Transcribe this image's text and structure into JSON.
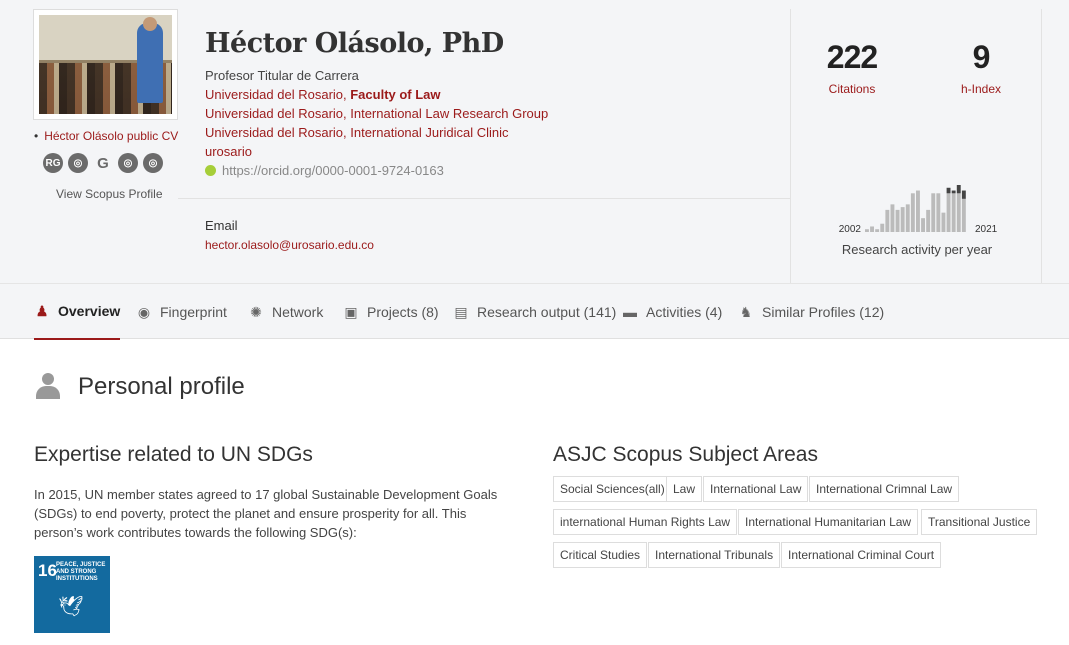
{
  "profile": {
    "name": "Héctor Olásolo, PhD",
    "cv_link": "Héctor Olásolo public CV",
    "scopus_link": "View Scopus Profile",
    "ext_icons": [
      "RG",
      "globe-icon",
      "google-icon",
      "globe-icon",
      "globe-icon"
    ],
    "title": "Profesor Titular de Carrera",
    "affil1_org": "Universidad del Rosario, ",
    "affil1_unit": "Faculty of Law",
    "affil2": "Universidad del Rosario, International Law Research Group",
    "affil3": "Universidad del Rosario, International Juridical Clinic",
    "affil4": "urosario",
    "orcid": "https://orcid.org/0000-0001-9724-0163",
    "email_label": "Email",
    "email": "hector.olasolo@urosario.edu.co"
  },
  "stats": {
    "citations_value": "222",
    "citations_label": "Citations",
    "hindex_value": "9",
    "hindex_label": "h-Index",
    "activity_label": "Research activity per year"
  },
  "chart_data": {
    "type": "bar",
    "start_label": "2002",
    "end_label": "2021",
    "x": [
      2002,
      2003,
      2004,
      2005,
      2006,
      2007,
      2008,
      2009,
      2010,
      2011,
      2012,
      2013,
      2014,
      2015,
      2016,
      2017,
      2018,
      2019,
      2020,
      2021
    ],
    "series": [
      {
        "values": [
          1,
          2,
          1,
          3,
          8,
          10,
          8,
          9,
          10,
          14,
          15,
          5,
          8,
          14,
          14,
          7,
          14,
          14,
          14,
          12
        ]
      },
      {
        "values": [
          0,
          0,
          0,
          0,
          0,
          0,
          0,
          0,
          0,
          0,
          0,
          0,
          0,
          0,
          0,
          0,
          2,
          1,
          3,
          3
        ]
      }
    ],
    "colors": [
      "#bbbbbb",
      "#444444"
    ]
  },
  "tabs": [
    {
      "label": "Overview",
      "icon": "person-icon"
    },
    {
      "label": "Fingerprint",
      "icon": "fingerprint-icon"
    },
    {
      "label": "Network",
      "icon": "network-icon"
    },
    {
      "label": "Projects (8)",
      "icon": "box-icon"
    },
    {
      "label": "Research output (141)",
      "icon": "book-icon"
    },
    {
      "label": "Activities (4)",
      "icon": "briefcase-icon"
    },
    {
      "label": "Similar Profiles (12)",
      "icon": "people-icon"
    }
  ],
  "personal_profile": {
    "title": "Personal profile",
    "sdg_title": "Expertise related to UN SDGs",
    "sdg_text": "In 2015, UN member states agreed to 17 global Sustainable Development Goals (SDGs) to end poverty, protect the planet and ensure prosperity for all. This person’s work contributes towards the following SDG(s):",
    "sdg_number": "16",
    "sdg_label": "PEACE, JUSTICE AND STRONG INSTITUTIONS",
    "asjc_title": "ASJC Scopus Subject Areas",
    "asjc_tags": [
      "Social Sciences(all)",
      "Law",
      "International Law",
      "International Crimnal Law",
      "international Human Rights Law",
      "International Humanitarian Law",
      "Transitional Justice",
      "Critical Studies",
      "International Tribunals",
      "International Criminal Court"
    ]
  },
  "colors": {
    "accent": "#9b1a1a",
    "header_bg": "#f4f5f7",
    "sdg_blue": "#136a9f"
  }
}
